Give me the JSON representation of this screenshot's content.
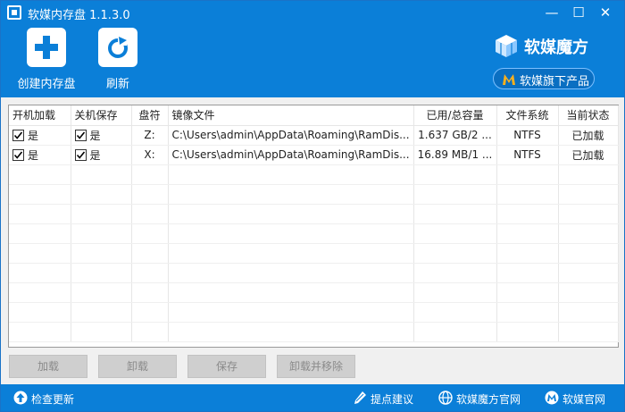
{
  "app": {
    "title": "软媒内存盘 1.1.3.0",
    "window_controls": {
      "minimize": "—",
      "maximize": "☐",
      "close": "✕"
    }
  },
  "toolbar": {
    "create_label": "创建内存盘",
    "refresh_label": "刷新",
    "brand": "软媒魔方",
    "products_label": "软媒旗下产品"
  },
  "table": {
    "columns": [
      "开机加载",
      "关机保存",
      "盘符",
      "镜像文件",
      "已用/总容量",
      "文件系统",
      "当前状态"
    ],
    "rows": [
      {
        "boot_load": "是",
        "boot_load_checked": true,
        "shutdown_save": "是",
        "shutdown_save_checked": true,
        "drive": "Z:",
        "image": "C:\\Users\\admin\\AppData\\Roaming\\RamDis...",
        "usage": "1.637 GB/2 ...",
        "fs": "NTFS",
        "status": "已加载"
      },
      {
        "boot_load": "是",
        "boot_load_checked": true,
        "shutdown_save": "是",
        "shutdown_save_checked": true,
        "drive": "X:",
        "image": "C:\\Users\\admin\\AppData\\Roaming\\RamDis...",
        "usage": "16.89 MB/1 ...",
        "fs": "NTFS",
        "status": "已加载"
      }
    ]
  },
  "actions": {
    "load": "加载",
    "unload": "卸载",
    "save": "保存",
    "unload_remove": "卸载并移除"
  },
  "footer": {
    "update": "检查更新",
    "suggest": "提点建议",
    "magic_site": "软媒魔方官网",
    "official_site": "软媒官网"
  },
  "colors": {
    "accent": "#0b7fd8",
    "button_disabled_bg": "#cfcfcf",
    "button_disabled_text": "#8a8a8a"
  }
}
